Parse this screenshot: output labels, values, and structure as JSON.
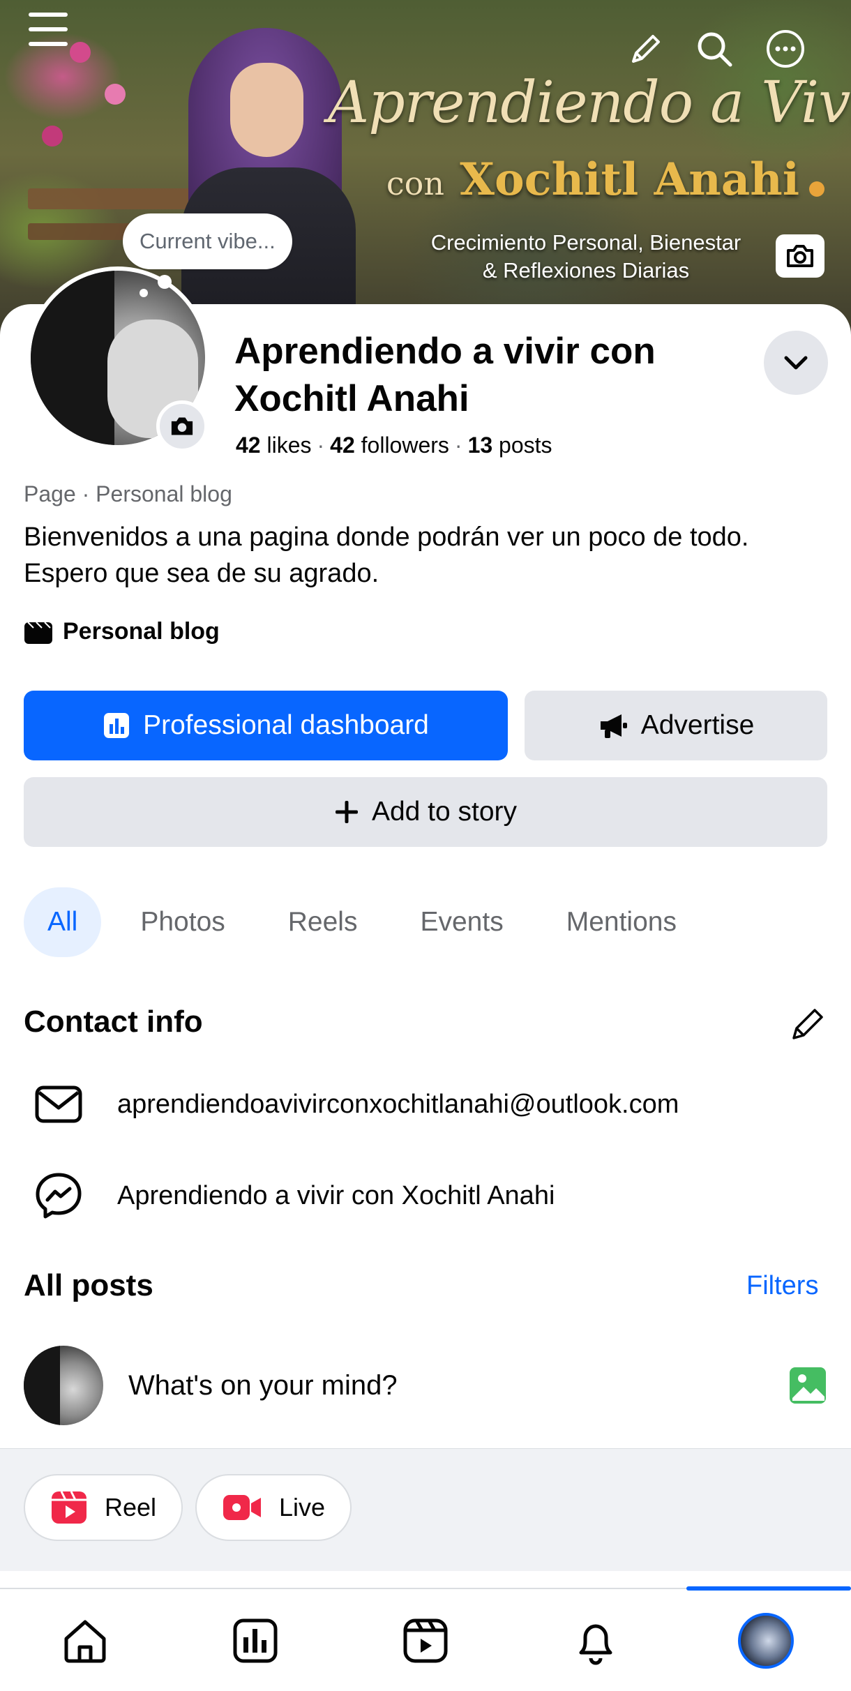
{
  "cover": {
    "title_line1": "Aprendiendo a Vivir",
    "title_line2_prefix": "con",
    "title_line2_name": "Xochitl Anahi",
    "tagline_line1": "Crecimiento Personal, Bienestar",
    "tagline_line2": "& Reflexiones Diarias"
  },
  "profile": {
    "vibe_placeholder": "Current vibe...",
    "name": "Aprendiendo a vivir con Xochitl Anahi",
    "stats": {
      "likes_count": "42",
      "likes_label": "likes",
      "followers_count": "42",
      "followers_label": "followers",
      "posts_count": "13",
      "posts_label": "posts"
    },
    "category_line": "Page · Personal blog",
    "bio": "Bienvenidos a una pagina donde podrán ver un poco de todo. Espero que sea de su agrado.",
    "blog_label": "Personal blog"
  },
  "buttons": {
    "dashboard": "Professional dashboard",
    "advertise": "Advertise",
    "add_story": "Add to story"
  },
  "tabs": [
    {
      "label": "All",
      "active": true
    },
    {
      "label": "Photos",
      "active": false
    },
    {
      "label": "Reels",
      "active": false
    },
    {
      "label": "Events",
      "active": false
    },
    {
      "label": "Mentions",
      "active": false
    }
  ],
  "contact": {
    "title": "Contact info",
    "email": "aprendiendoavivirconxochitlanahi@outlook.com",
    "messenger": "Aprendiendo a vivir con Xochitl Anahi"
  },
  "posts": {
    "title": "All posts",
    "filters": "Filters",
    "composer_prompt": "What's on your mind?",
    "reel_label": "Reel",
    "live_label": "Live"
  },
  "bottom_nav": [
    "home-icon",
    "dashboard-icon",
    "video-icon",
    "bell-icon",
    "profile-avatar"
  ],
  "colors": {
    "accent": "#0866ff",
    "button_gray": "#e4e6eb",
    "secondary_text": "#65676b",
    "photo_green": "#45bd62",
    "reel_red": "#f02849"
  }
}
